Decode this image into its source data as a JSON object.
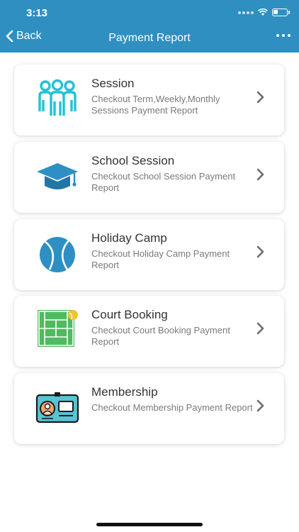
{
  "status": {
    "time": "3:13"
  },
  "nav": {
    "back_label": "Back",
    "title": "Payment Report"
  },
  "items": [
    {
      "title": "Session",
      "description": "Checkout Term,Weekly,Monthly Sessions Payment Report",
      "icon": "people-icon"
    },
    {
      "title": "School Session",
      "description": "Checkout School Session Payment Report",
      "icon": "graduation-cap-icon"
    },
    {
      "title": "Holiday Camp",
      "description": "Checkout Holiday Camp Payment Report",
      "icon": "tennis-ball-icon"
    },
    {
      "title": "Court Booking",
      "description": "Checkout Court Booking Payment Report",
      "icon": "tennis-court-icon"
    },
    {
      "title": "Membership",
      "description": "Checkout Membership Payment Report",
      "icon": "id-card-icon"
    }
  ],
  "colors": {
    "header": "#2e8fc0",
    "icon_blue": "#2d8fc4",
    "icon_teal": "#22c1d6",
    "court_green": "#4fbb5f"
  }
}
